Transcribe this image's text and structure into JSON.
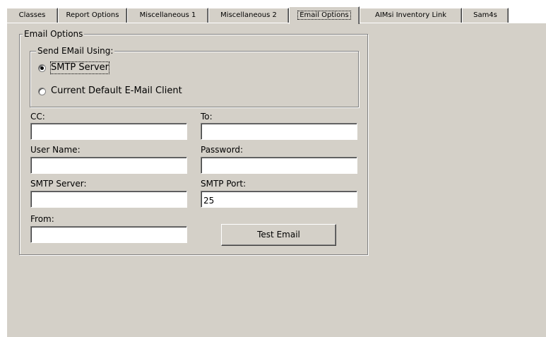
{
  "tabs": [
    {
      "label": "Classes",
      "active": false
    },
    {
      "label": "Report Options",
      "active": false
    },
    {
      "label": "Miscellaneous 1",
      "active": false
    },
    {
      "label": "Miscellaneous 2",
      "active": false
    },
    {
      "label": "Email Options",
      "active": true
    },
    {
      "label": "AIMsi Inventory Link",
      "active": false
    },
    {
      "label": "Sam4s",
      "active": false
    }
  ],
  "email_options": {
    "group_title": "Email Options",
    "send_group": {
      "title": "Send EMail Using:",
      "options": [
        {
          "label": "SMTP Server",
          "checked": true
        },
        {
          "label": "Current Default E-Mail Client",
          "checked": false
        }
      ]
    },
    "fields": {
      "cc": {
        "label": "CC:",
        "value": ""
      },
      "to": {
        "label": "To:",
        "value": ""
      },
      "user_name": {
        "label": "User Name:",
        "value": ""
      },
      "password": {
        "label": "Password:",
        "value": ""
      },
      "smtp_server": {
        "label": "SMTP Server:",
        "value": ""
      },
      "smtp_port": {
        "label": "SMTP Port:",
        "value": "25"
      },
      "from": {
        "label": "From:",
        "value": ""
      }
    },
    "test_button": "Test Email"
  },
  "colors": {
    "face": "#d4d0c8",
    "shadow": "#808080",
    "dark_shadow": "#404040",
    "highlight": "#ffffff"
  }
}
